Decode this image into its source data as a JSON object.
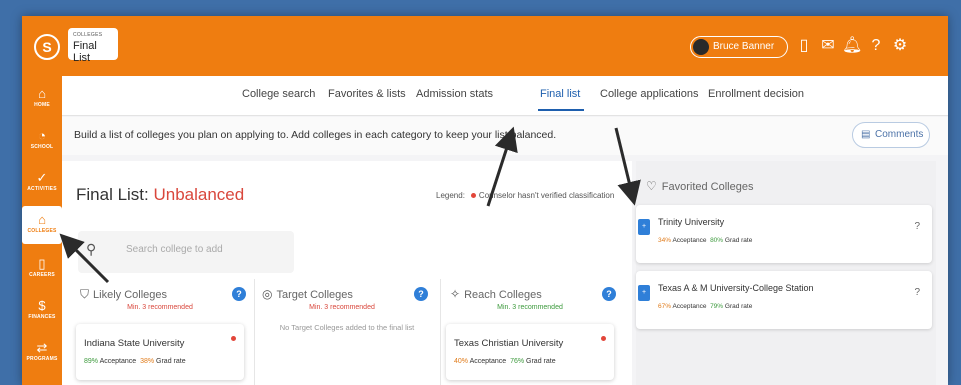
{
  "header": {
    "logo_glyph": "S",
    "section_label": "COLLEGES",
    "page_title": "Final List",
    "user_name": "Bruce Banner",
    "icons": [
      "document-icon",
      "mail-icon",
      "bell-icon",
      "help-icon",
      "gear-icon"
    ],
    "icon_glyphs": [
      "▯",
      "✉",
      "🔔︎",
      "?",
      "⚙"
    ]
  },
  "sidebar": {
    "items": [
      {
        "label": "HOME",
        "glyph": "⌂",
        "icon": "home-icon"
      },
      {
        "label": "SCHOOL",
        "glyph": "◔",
        "icon": "school-icon"
      },
      {
        "label": "ACTIVITIES",
        "glyph": "✓",
        "icon": "activities-icon"
      },
      {
        "label": "COLLEGES",
        "glyph": "⌂",
        "icon": "colleges-icon",
        "active": true
      },
      {
        "label": "CAREERS",
        "glyph": "▯",
        "icon": "careers-icon"
      },
      {
        "label": "FINANCES",
        "glyph": "$",
        "icon": "finances-icon"
      },
      {
        "label": "PROGRAMS",
        "glyph": "⇄",
        "icon": "programs-icon"
      }
    ]
  },
  "tabs": [
    {
      "label": "College search"
    },
    {
      "label": "Favorites & lists"
    },
    {
      "label": "Admission stats"
    },
    {
      "label": "Final list",
      "active": true
    },
    {
      "label": "College applications"
    },
    {
      "label": "Enrollment decision"
    }
  ],
  "info_text": "Build a list of colleges you plan on applying to. Add colleges in each category to keep your list balanced.",
  "comments_label": "Comments",
  "final_list": {
    "title_prefix": "Final List:",
    "status": "Unbalanced",
    "legend_label": "Legend:",
    "legend_text": "Counselor hasn't verified classification",
    "search_placeholder": "Search college to add"
  },
  "categories": [
    {
      "name": "Likely Colleges",
      "icon": "shield-icon",
      "glyph": "⛉",
      "min_text": "Min. 3 recommended",
      "min_color": "#d9473c",
      "colleges": [
        {
          "name": "Indiana State University",
          "acceptance": "89%",
          "grad_rate": "38%"
        }
      ]
    },
    {
      "name": "Target Colleges",
      "icon": "target-icon",
      "glyph": "◎",
      "min_text": "Min. 3 recommended",
      "min_color": "#d9473c",
      "empty_text": "No Target Colleges added to the final list",
      "colleges": []
    },
    {
      "name": "Reach Colleges",
      "icon": "reach-icon",
      "glyph": "✧",
      "min_text": "Min. 3 recommended",
      "min_color": "#3d9a3d",
      "colleges": [
        {
          "name": "Texas Christian University",
          "acceptance": "40%",
          "grad_rate": "76%"
        }
      ]
    }
  ],
  "stat_labels": {
    "acceptance": "Acceptance",
    "grad_rate": "Grad rate"
  },
  "favorites": {
    "title": "Favorited Colleges",
    "colleges": [
      {
        "name": "Trinity University",
        "acceptance": "34%",
        "grad_rate": "80%"
      },
      {
        "name": "Texas A & M University-College Station",
        "acceptance": "67%",
        "grad_rate": "79%"
      }
    ]
  },
  "colors": {
    "accent": "#ef7d10",
    "link": "#1e5fae",
    "help": "#2f7fd8",
    "alert": "#d9473c"
  }
}
